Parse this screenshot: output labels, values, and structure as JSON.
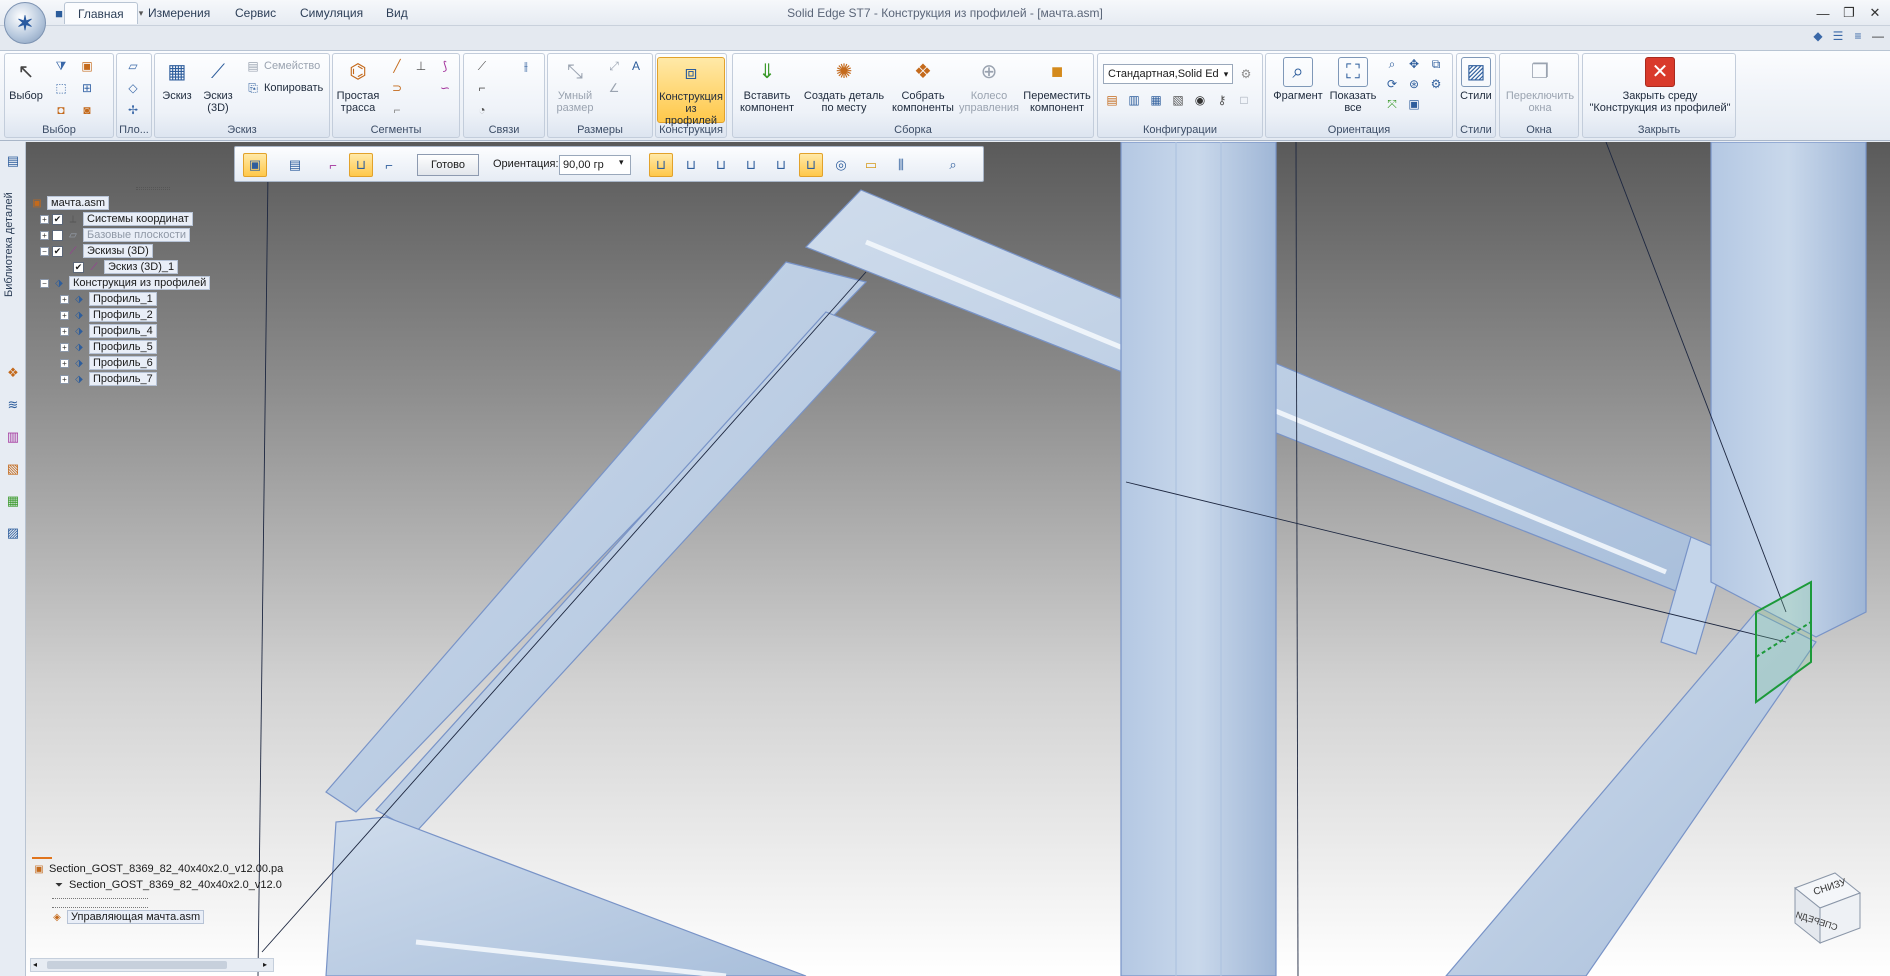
{
  "app": {
    "title": "Solid Edge ST7 - Конструкция из профилей - [мачта.asm]"
  },
  "quick_access": [
    "save-icon",
    "undo-icon",
    "redo-icon",
    "customize-icon"
  ],
  "window_controls": [
    "minimize",
    "restore",
    "close"
  ],
  "tabs": [
    {
      "label": "Главная",
      "active": true
    },
    {
      "label": "Измерения"
    },
    {
      "label": "Сервис"
    },
    {
      "label": "Симуляция"
    },
    {
      "label": "Вид"
    }
  ],
  "ribbon": {
    "select": {
      "label": "Выбор",
      "btn": "Выбор"
    },
    "plo": {
      "label": "Пло..."
    },
    "sketch": {
      "label": "Эскиз",
      "b1": "Эскиз",
      "b2a": "Эскиз",
      "b2b": "(3D)",
      "family": "Семейство",
      "copy": "Копировать"
    },
    "segments": {
      "label": "Сегменты",
      "b1a": "Простая",
      "b1b": "трасса"
    },
    "relations": {
      "label": "Связи"
    },
    "dimensions": {
      "label": "Размеры",
      "b1a": "Умный",
      "b1b": "размер"
    },
    "frame": {
      "label": "Конструкция",
      "b1a": "Конструкция",
      "b1b": "из профилей"
    },
    "assembly": {
      "label": "Сборка",
      "b1a": "Вставить",
      "b1b": "компонент",
      "b2a": "Создать деталь",
      "b2b": "по месту",
      "b3a": "Собрать",
      "b3b": "компоненты",
      "b4a": "Колесо",
      "b4b": "управления",
      "b5a": "Переместить",
      "b5b": "компонент"
    },
    "configs": {
      "label": "Конфигурации",
      "value": "Стандартная,Solid Ed"
    },
    "orient": {
      "label": "Ориентация",
      "b1": "Фрагмент",
      "b2a": "Показать",
      "b2b": "все"
    },
    "styles": {
      "label": "Стили",
      "b1": "Стили"
    },
    "windows": {
      "label": "Окна",
      "b1a": "Переключить",
      "b1b": "окна"
    },
    "close": {
      "label": "Закрыть",
      "b1a": "Закрыть среду",
      "b1b": "\"Конструкция из профилей\""
    }
  },
  "side_tab": "Библиотека деталей",
  "command_bar": {
    "done": "Готово",
    "orientation_label": "Ориентация:",
    "orientation_value": "90,00 гр"
  },
  "tree": [
    {
      "label": "мачта.asm"
    },
    {
      "label": "Системы координат"
    },
    {
      "label": "Базовые плоскости"
    },
    {
      "label": "Эскизы (3D)"
    },
    {
      "label": "Эскиз (3D)_1"
    },
    {
      "label": "Конструкция из профилей"
    },
    {
      "label": "Профиль_1"
    },
    {
      "label": "Профиль_2"
    },
    {
      "label": "Профиль_4"
    },
    {
      "label": "Профиль_5"
    },
    {
      "label": "Профиль_6"
    },
    {
      "label": "Профиль_7"
    }
  ],
  "lower": [
    {
      "label": "Section_GOST_8369_82_40x40x2.0_v12.00.pa"
    },
    {
      "label": "Section_GOST_8369_82_40x40x2.0_v12.0"
    },
    {
      "label": "Управляющая мачта.asm"
    }
  ],
  "view_cube": {
    "top": "СНИЗУ",
    "side": "СПЕРЕДИ"
  },
  "colors": {
    "accent": "#ffc84a",
    "profile_fill": "#b9cde6",
    "profile_edge": "#6d8fd0",
    "selection": "#1c9a3a"
  }
}
